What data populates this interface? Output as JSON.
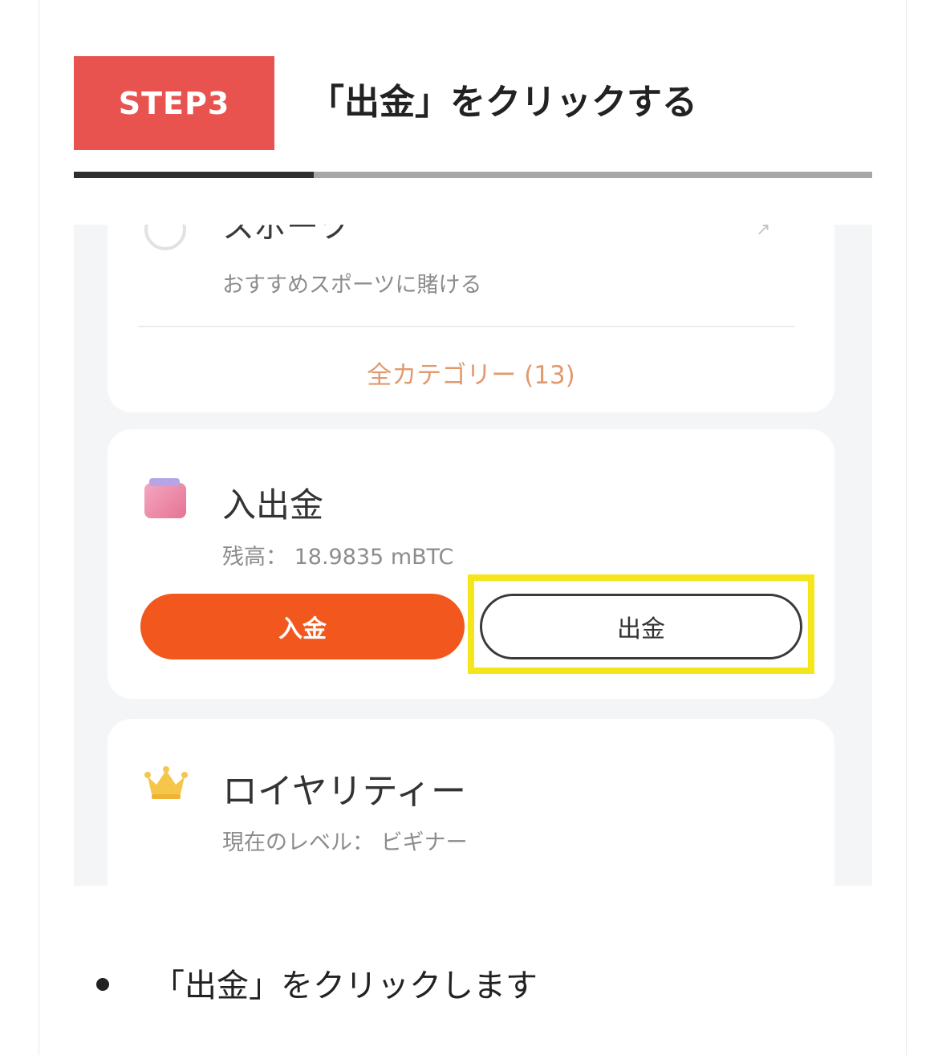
{
  "header": {
    "step_label": "STEP3",
    "title": "「出金」をクリックする",
    "progress_fraction": 0.3
  },
  "screenshot": {
    "sports": {
      "title": "スポーツ",
      "subtitle": "おすすめスポーツに賭ける",
      "all_categories": "全カテゴリー (13)"
    },
    "wallet": {
      "title": "入出金",
      "balance": "残高： 18.9835 mBTC",
      "deposit_label": "入金",
      "withdraw_label": "出金"
    },
    "loyalty": {
      "title": "ロイヤリティー",
      "level": "現在のレベル： ビギナー"
    }
  },
  "instructions": {
    "bullet": "「出金」をクリックします"
  },
  "colors": {
    "step_badge": "#e85350",
    "deposit_button": "#f2571d",
    "highlight_box": "#f5e61b"
  },
  "icons": {
    "sports": "circle-icon",
    "wallet": "wallet-icon",
    "loyalty": "crown-icon"
  }
}
